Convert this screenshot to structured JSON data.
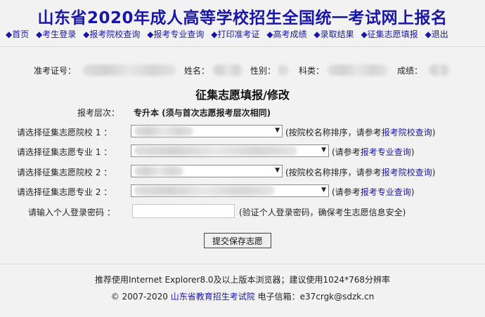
{
  "header": {
    "title": "山东省2020年成人高等学校招生全国统一考试网上报名",
    "nav": [
      {
        "label": "◆首页"
      },
      {
        "label": "◆考生登录"
      },
      {
        "label": "◆报考院校查询"
      },
      {
        "label": "◆报考专业查询"
      },
      {
        "label": "◆打印准考证"
      },
      {
        "label": "◆高考成绩"
      },
      {
        "label": "◆录取结果"
      },
      {
        "label": "◆征集志愿填报"
      },
      {
        "label": "◆退出"
      }
    ]
  },
  "info": {
    "exam_no_label": "准考证号：",
    "name_label": "姓名：",
    "gender_label": "性别：",
    "subject_label": "科类：",
    "score_label": "成绩："
  },
  "form": {
    "title": "征集志愿填报/修改",
    "level_label": "报考层次：",
    "level_value": "专升本 (须与首次志愿报考层次相同)",
    "school1_label": "请选择征集志愿院校 1 ：",
    "school1_note_prefix": "(按院校名称排序，请参考",
    "school1_note_link": "报考院校查询",
    "school1_note_suffix": ")",
    "major1_label": "请选择征集志愿专业 1 ：",
    "major1_note_prefix": "(请参考",
    "major1_note_link": "报考专业查询",
    "major1_note_suffix": ")",
    "school2_label": "请选择征集志愿院校 2 ：",
    "school2_note_prefix": "(按院校名称排序，请参考",
    "school2_note_link": "报考院校查询",
    "school2_note_suffix": ")",
    "major2_label": "请选择征集志愿专业 2 ：",
    "major2_note_prefix": "(请参考",
    "major2_note_link": "报考专业查询",
    "major2_note_suffix": ")",
    "password_label": "请输入个人登录密码 ：",
    "password_note": "(验证个人登录密码，确保考生志愿信息安全)",
    "submit_label": "提交保存志愿"
  },
  "footer": {
    "line1": "推荐使用Internet Explorer8.0及以上版本浏览器；建议使用1024*768分辨率",
    "copyright_prefix": "© 2007-2020 ",
    "copyright_link": "山东省教育招生考试院",
    "email_label": " 电子信箱：e37crgk@sdzk.cn"
  }
}
